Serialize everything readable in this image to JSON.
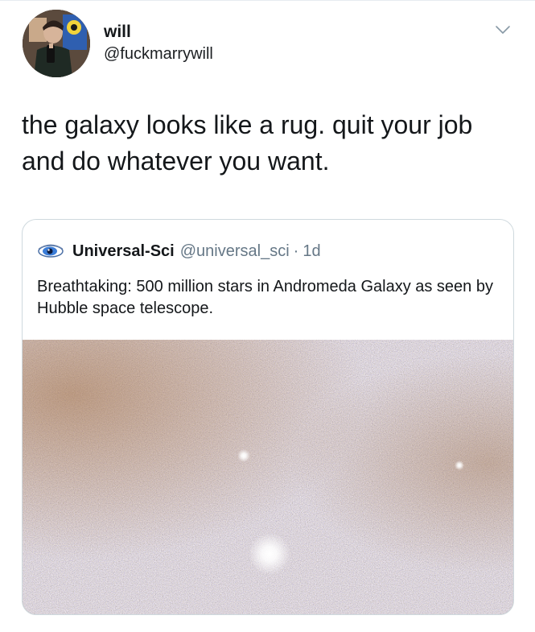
{
  "tweet": {
    "author": {
      "display_name": "will",
      "handle": "@fuckmarrywill",
      "avatar_icon": "profile-photo-avatar"
    },
    "menu_icon": "chevron-down-icon",
    "text": "the galaxy looks like a rug. quit your job and do whatever you want."
  },
  "quote": {
    "author": {
      "display_name": "Universal-Sci",
      "handle": "@universal_sci",
      "separator": "·",
      "time": "1d",
      "avatar_icon": "eye-logo-avatar"
    },
    "text": "Breathtaking: 500 million stars in Andromeda Galaxy as seen by Hubble space telescope.",
    "media_icon": "andromeda-star-field-image"
  },
  "colors": {
    "text": "#14171a",
    "secondary_text": "#657786",
    "border": "#cfd9de"
  }
}
